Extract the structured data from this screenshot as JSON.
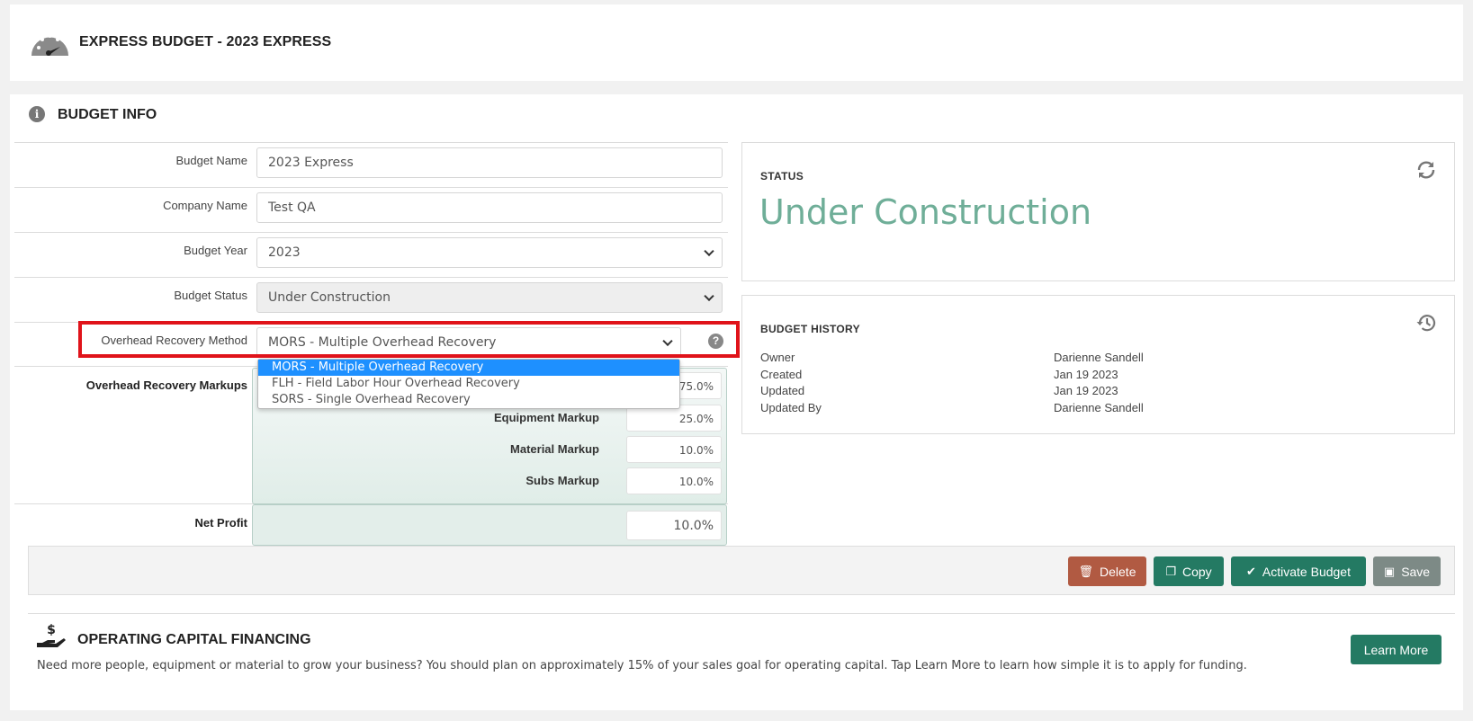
{
  "header": {
    "title": "EXPRESS BUDGET - 2023 EXPRESS",
    "icon": "gauge-icon"
  },
  "budget_info": {
    "title": "BUDGET INFO",
    "icon": "info-icon",
    "fields": {
      "budget_name": {
        "label": "Budget Name",
        "value": "2023 Express"
      },
      "company_name": {
        "label": "Company Name",
        "value": "Test QA"
      },
      "budget_year": {
        "label": "Budget Year",
        "value": "2023"
      },
      "budget_status": {
        "label": "Budget Status",
        "value": "Under Construction"
      },
      "overhead_method": {
        "label": "Overhead Recovery Method",
        "value": "MORS - Multiple Overhead Recovery"
      }
    },
    "overhead_options": [
      "MORS - Multiple Overhead Recovery",
      "FLH - Field Labor Hour Overhead Recovery",
      "SORS - Single Overhead Recovery"
    ],
    "markups": {
      "label": "Overhead Recovery Markups",
      "labor_value": "75.0%",
      "equipment_label": "Equipment Markup",
      "equipment_value": "25.0%",
      "material_label": "Material Markup",
      "material_value": "10.0%",
      "subs_label": "Subs Markup",
      "subs_value": "10.0%"
    },
    "net_profit": {
      "label": "Net Profit",
      "value": "10.0%"
    }
  },
  "status_card": {
    "title": "STATUS",
    "value": "Under Construction",
    "icon": "refresh-icon"
  },
  "history_card": {
    "title": "BUDGET HISTORY",
    "icon": "history-icon",
    "rows": [
      {
        "label": "Owner",
        "value": "Darienne Sandell"
      },
      {
        "label": "Created",
        "value": "Jan 19 2023"
      },
      {
        "label": "Updated",
        "value": "Jan 19 2023"
      },
      {
        "label": "Updated By",
        "value": "Darienne Sandell"
      }
    ]
  },
  "actions": {
    "delete": "Delete",
    "copy": "Copy",
    "activate": "Activate Budget",
    "save": "Save"
  },
  "financing": {
    "title": "OPERATING CAPITAL FINANCING",
    "text": "Need more people, equipment or material to grow your business? You should plan on approximately 15% of your sales goal for operating capital. Tap Learn More to learn how simple it is to apply for funding.",
    "button": "Learn More",
    "icon": "hand-dollar-icon"
  },
  "colors": {
    "status_green": "#6fae98",
    "primary_green": "#247a63",
    "delete_red": "#b15a42",
    "highlight_red": "#e0131a",
    "dropdown_blue": "#1e90ff"
  }
}
